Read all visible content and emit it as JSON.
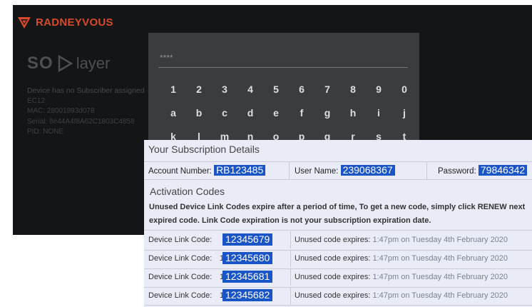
{
  "tv": {
    "brand": "RADNEYVOUS",
    "app_logo_a": "SO",
    "app_logo_b": "layer",
    "device_info": [
      "Device has no Subscriber assigned",
      "EC12",
      "MAC: 28001893d078",
      "Serial: 8e44A4f8A62C1803C4858",
      "PID: NONE"
    ]
  },
  "keyboard": {
    "input_text": "****",
    "rows": [
      [
        "1",
        "2",
        "3",
        "4",
        "5",
        "6",
        "7",
        "8",
        "9",
        "0"
      ],
      [
        "a",
        "b",
        "c",
        "d",
        "e",
        "f",
        "g",
        "h",
        "i",
        "j"
      ],
      [
        "k",
        "l",
        "m",
        "n",
        "o",
        "p",
        "q",
        "r",
        "s",
        "t"
      ]
    ]
  },
  "subscription": {
    "title": "Your Subscription Details",
    "account_label": "Account Number:",
    "account_value": "RB123485",
    "user_label": "User Name:",
    "user_value": "239068367",
    "password_label": "Password:",
    "password_value": "79846342",
    "activation_title": "Activation Codes",
    "desc_line1": "Unused Device Link Codes expire after a period of time, To get a new code, simply click RENEW next",
    "desc_line2": "expired code. Link Code expiration is not your subscription expiration date.",
    "codes": [
      {
        "label": "Device Link Code:",
        "code": "12345679",
        "tick": "",
        "expires_label": "Unused code expires:",
        "expires_value": "1:47pm on Tuesday 4th February 2020"
      },
      {
        "label": "Device Link Code:",
        "code": "12345680",
        "tick": "1",
        "expires_label": "Unused code expires:",
        "expires_value": "1:47pm on Tuesday 4th February 2020"
      },
      {
        "label": "Device Link Code:",
        "code": "12345681",
        "tick": "1",
        "expires_label": "Unused code expires:",
        "expires_value": "1:47pm on Tuesday 4th February 2020"
      },
      {
        "label": "Device Link Code:",
        "code": "12345682",
        "tick": "1",
        "expires_label": "Unused code expires:",
        "expires_value": "1:47pm on Tuesday 4th February 2020"
      }
    ]
  },
  "colors": {
    "brand": "#d84a2a",
    "highlight": "#1a55c7",
    "tv_bg": "#141516",
    "keyboard_bg": "#3b3c3f",
    "panel_bg": "#e9ecf7"
  }
}
